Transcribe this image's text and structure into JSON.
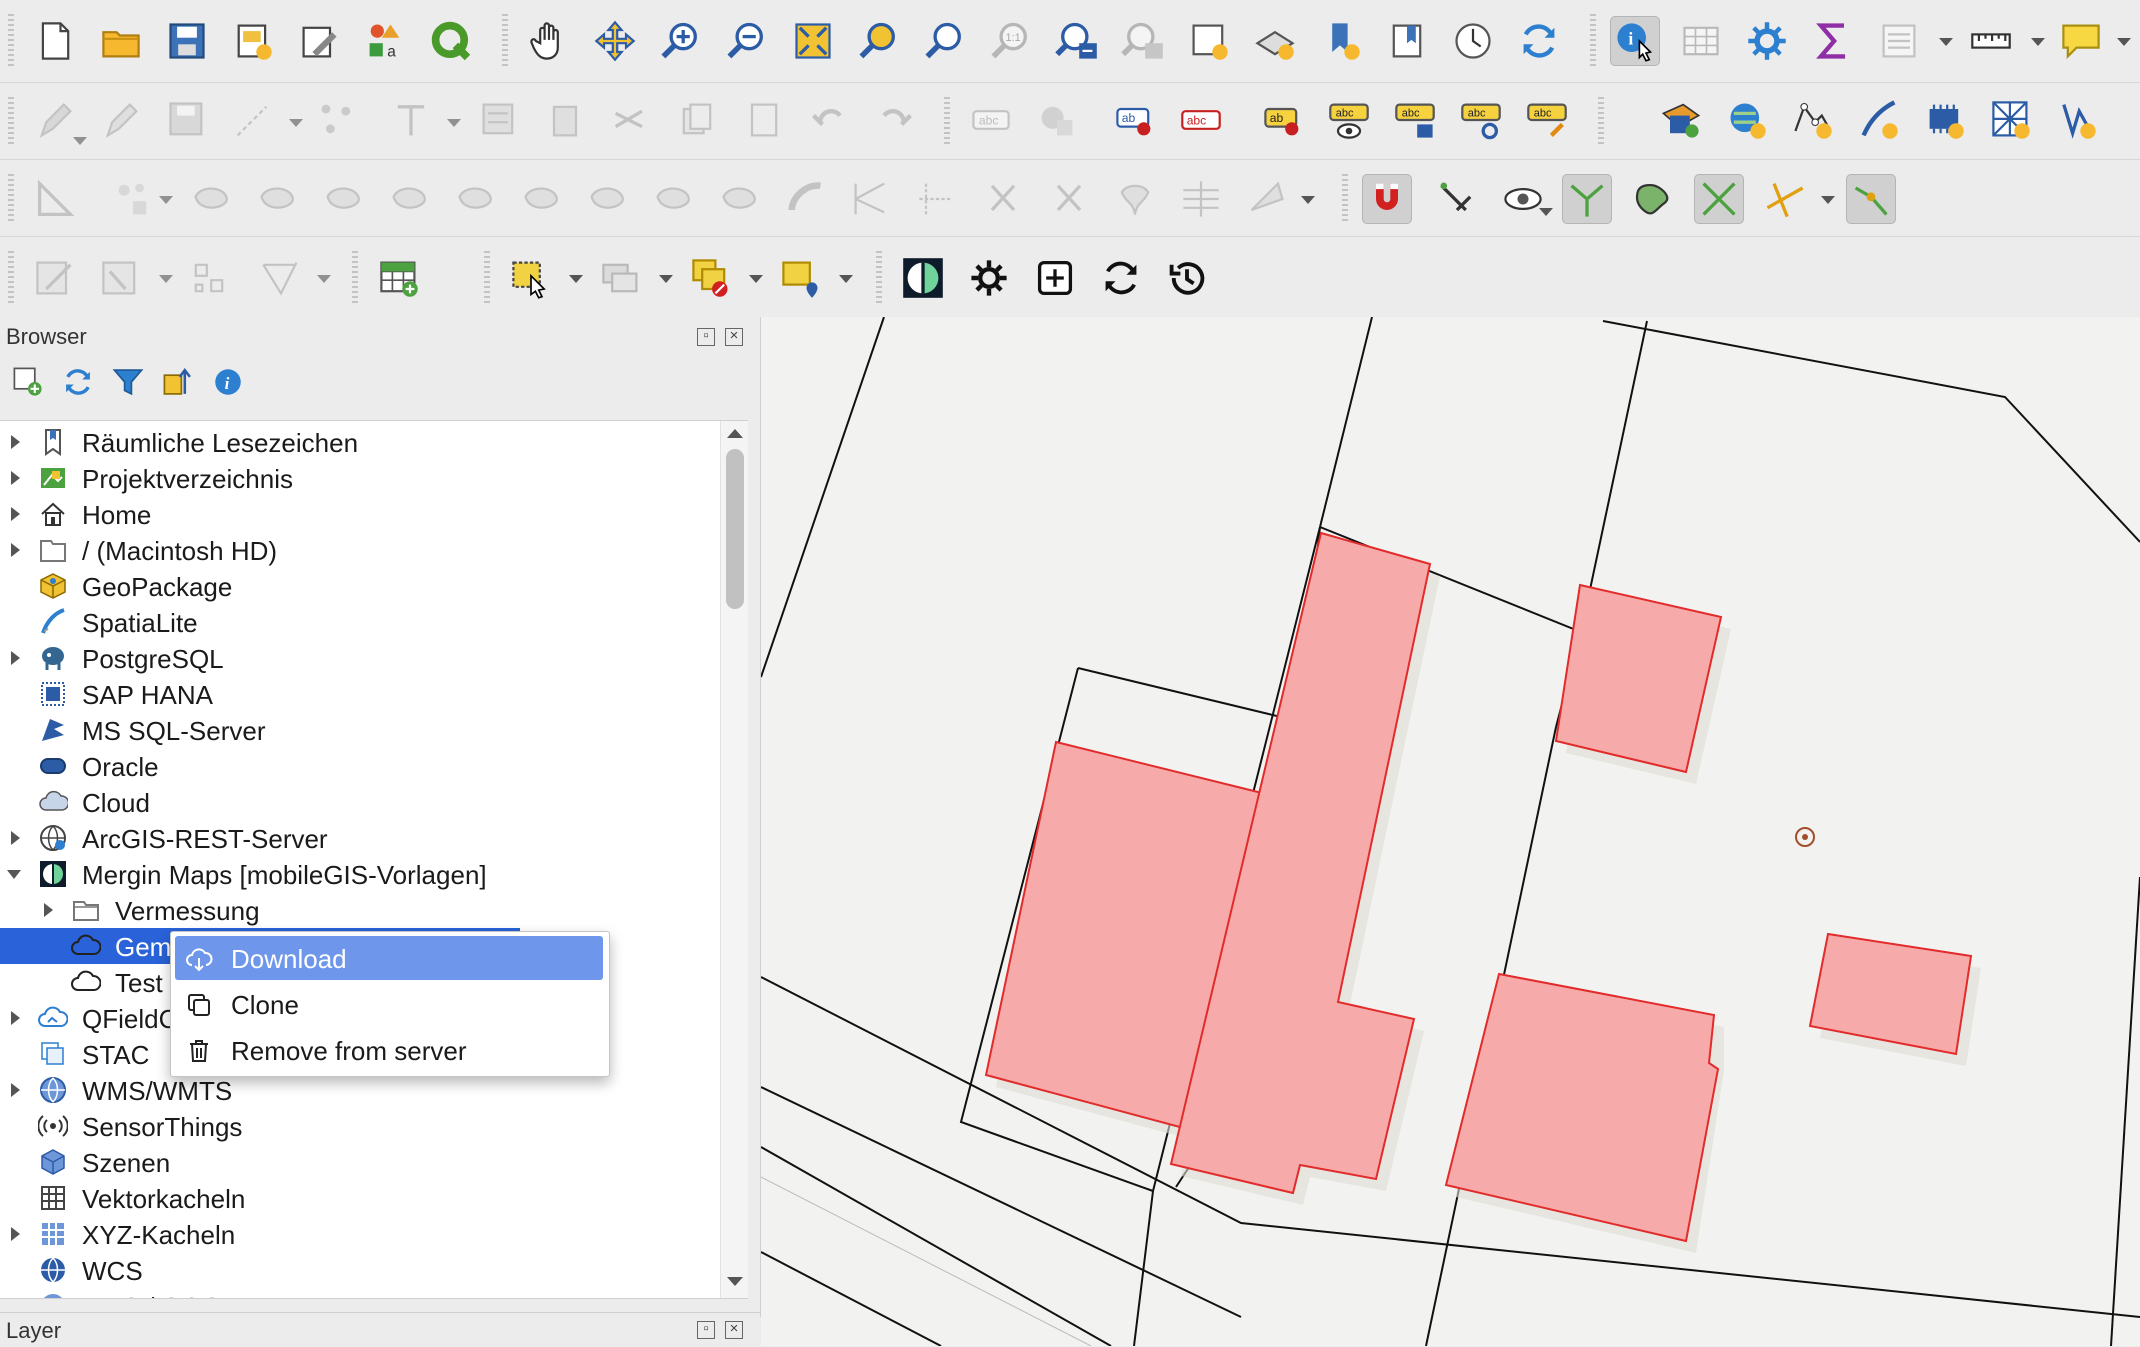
{
  "toolbars": {
    "file": [
      "new-project-icon",
      "open-folder-icon",
      "save-icon",
      "new-print-layout-icon",
      "style-manager-icon",
      "layout-manager-icon",
      "qgis-logo-icon"
    ],
    "navigation": [
      "pan-hand-icon",
      "pan-to-selection-icon",
      "zoom-in-icon",
      "zoom-out-icon",
      "zoom-full-icon",
      "zoom-to-selection-icon",
      "zoom-to-layer-icon",
      "zoom-native-icon",
      "zoom-last-icon",
      "zoom-next-icon",
      "new-map-view-icon",
      "new-3d-view-icon",
      "new-bookmark-icon",
      "show-bookmarks-icon",
      "temporal-controller-icon",
      "refresh-icon"
    ],
    "attributes": [
      "identify-features-icon",
      "open-attribute-table-icon",
      "toolbox-icon",
      "statistics-icon",
      "open-field-calculator-icon",
      "measure-line-icon",
      "map-tips-icon"
    ],
    "digitizing": [
      "current-edits-icon",
      "toggle-editing-icon",
      "save-layer-edits-icon",
      "add-feature-icon",
      "vertex-tool-icon",
      "modify-attributes-icon",
      "delete-selected-icon",
      "cut-features-icon",
      "copy-features-icon",
      "paste-features-icon",
      "undo-icon",
      "redo-icon"
    ],
    "labels": [
      "label-toolbar-icon",
      "diagram-icon",
      "layer-labeling-icon",
      "layer-diagram-icon",
      "pin-label-icon",
      "show-hide-label-icon",
      "move-label-icon",
      "rotate-label-icon",
      "change-label-icon"
    ],
    "data_source": [
      "new-shapefile-icon",
      "new-spatialite-icon",
      "new-geopackage-icon",
      "new-virtual-layer-icon",
      "new-memory-layer-icon",
      "new-mesh-layer-icon",
      "new-gps-layer-icon"
    ],
    "advanced_digitizing": [
      "advanced-digitizing-icon",
      "add-ring-icon",
      "offset-curve-icon",
      "reshape-icon",
      "split-icon",
      "merge-icon",
      "rotate-icon",
      "simplify-icon",
      "fill-ring-icon",
      "delete-ring-icon",
      "delete-part-icon",
      "reshape-features-icon",
      "split-parts-icon",
      "trim-extend-icon",
      "snapping-icon",
      "enable-tracing-icon",
      "topological-editing-icon",
      "avoid-overlap-icon",
      "snapping-intersection-icon",
      "self-snapping-icon"
    ],
    "plugins": [
      "georeferencer-icon",
      "grid-tool-icon",
      "shape-digitizing-icon",
      "vertex-editor-icon",
      "new-table-icon",
      "select-features-icon",
      "select-by-value-icon",
      "deselect-icon",
      "select-by-location-icon",
      "mergin-maps-icon",
      "mergin-settings-icon",
      "mergin-new-project-icon",
      "mergin-sync-icon",
      "mergin-history-icon"
    ]
  },
  "browser": {
    "title": "Browser",
    "items": [
      {
        "label": "Räumliche Lesezeichen",
        "icon": "bookmarks-icon",
        "expand": "r"
      },
      {
        "label": "Projektverzeichnis",
        "icon": "project-home-icon",
        "expand": "r"
      },
      {
        "label": "Home",
        "icon": "home-icon",
        "expand": "r"
      },
      {
        "label": "/ (Macintosh HD)",
        "icon": "drive-icon",
        "expand": "r"
      },
      {
        "label": "GeoPackage",
        "icon": "geopackage-icon",
        "expand": ""
      },
      {
        "label": "SpatiaLite",
        "icon": "spatialite-icon",
        "expand": ""
      },
      {
        "label": "PostgreSQL",
        "icon": "postgresql-icon",
        "expand": "r"
      },
      {
        "label": "SAP HANA",
        "icon": "sap-hana-icon",
        "expand": ""
      },
      {
        "label": "MS SQL-Server",
        "icon": "mssql-icon",
        "expand": ""
      },
      {
        "label": "Oracle",
        "icon": "oracle-icon",
        "expand": ""
      },
      {
        "label": "Cloud",
        "icon": "cloud-icon",
        "expand": ""
      },
      {
        "label": "ArcGIS-REST-Server",
        "icon": "arcgis-rest-icon",
        "expand": "r"
      },
      {
        "label": "Mergin Maps [mobileGIS-Vorlagen]",
        "icon": "mergin-maps-icon",
        "expand": "d"
      },
      {
        "label": "Vermessung",
        "icon": "folder-icon",
        "expand": "r",
        "indent": 1
      },
      {
        "label": "Gem",
        "icon": "cloud-project-icon",
        "expand": "",
        "indent": 1,
        "selected": true
      },
      {
        "label": "Test",
        "icon": "cloud-project-icon",
        "expand": "",
        "indent": 1
      },
      {
        "label": "QFieldC",
        "icon": "qfieldcloud-icon",
        "expand": "r"
      },
      {
        "label": "STAC",
        "icon": "stac-icon",
        "expand": ""
      },
      {
        "label": "WMS/WMTS",
        "icon": "wms-icon",
        "expand": "r"
      },
      {
        "label": "SensorThings",
        "icon": "sensorthings-icon",
        "expand": ""
      },
      {
        "label": "Szenen",
        "icon": "scenes-icon",
        "expand": ""
      },
      {
        "label": "Vektorkacheln",
        "icon": "vector-tiles-icon",
        "expand": ""
      },
      {
        "label": "XYZ-Kacheln",
        "icon": "xyz-tiles-icon",
        "expand": "r"
      },
      {
        "label": "WCS",
        "icon": "wcs-icon",
        "expand": ""
      },
      {
        "label": "WFS / OGC API - Features",
        "icon": "wfs-icon",
        "expand": "r"
      }
    ]
  },
  "context_menu": {
    "items": [
      {
        "label": "Download",
        "icon": "cloud-download-icon",
        "highlighted": true
      },
      {
        "label": "Clone",
        "icon": "clone-icon",
        "highlighted": false
      },
      {
        "label": "Remove from server",
        "icon": "trash-icon",
        "highlighted": false
      }
    ]
  },
  "layer_panel": {
    "title": "Layer"
  },
  "colors": {
    "building_fill": "#f6aaa9",
    "building_stroke": "#e22b2b",
    "parcel_line": "#111111",
    "selection": "#2962d9",
    "menu_highlight": "#6e97eb"
  }
}
